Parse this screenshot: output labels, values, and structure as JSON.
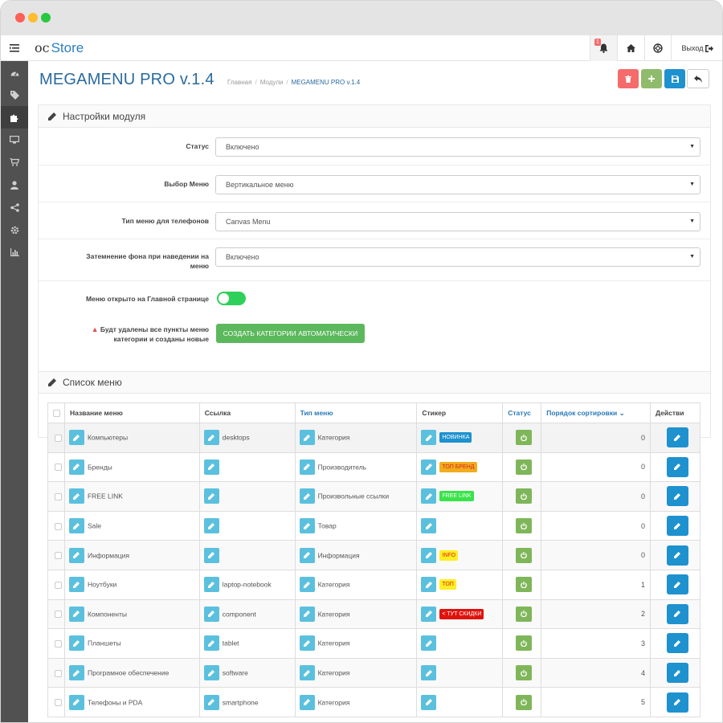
{
  "app": {
    "logo_oc": "oc",
    "logo_store": "Store",
    "notification_count": "1",
    "logout_label": "Выход"
  },
  "sidebar": {
    "items": [
      "dashboard-icon",
      "tags-icon",
      "puzzle-icon",
      "desktop-icon",
      "cart-icon",
      "user-icon",
      "share-icon",
      "gear-icon",
      "bar-chart-icon"
    ],
    "active_index": 2
  },
  "page": {
    "title": "MEGAMENU PRO v.1.4",
    "breadcrumb": [
      "Главная",
      "Модули",
      "MEGAMENU PRO v.1.4"
    ]
  },
  "settings": {
    "heading": "Настройки модуля",
    "status_label": "Статус",
    "status_value": "Включено",
    "menu_choice_label": "Выбор Меню",
    "menu_choice_value": "Вертикальное меню",
    "phone_menu_label": "Тип меню для телефонов",
    "phone_menu_value": "Canvas Menu",
    "dim_label_line1": "Затемнение фона при наведении на",
    "dim_label_line2": "меню",
    "dim_value": "Включено",
    "open_home_label": "Меню открыто на Главной странице",
    "open_home_on": true,
    "warning_line1": "Будт удалены все пункты меню",
    "warning_line2": "категории и созданы новые",
    "create_button": "СОЗДАТЬ КАТЕГОРИИ АВТОМАТИЧЕСКИ"
  },
  "list": {
    "heading": "Список меню",
    "columns": {
      "name": "Название меню",
      "link": "Ссылка",
      "type": "Тип меню",
      "sticker": "Стикер",
      "status": "Статус",
      "sort": "Порядок сортировки",
      "actions": "Действи"
    },
    "rows": [
      {
        "name": "Компьютеры",
        "link": "desktops",
        "type": "Категория",
        "sticker": "НОВИНКА",
        "sticker_bg": "#1e91cf",
        "sticker_fg": "#ffffff",
        "sort": "0"
      },
      {
        "name": "Бренды",
        "link": "",
        "type": "Производитель",
        "sticker": "ТОП БРЕНД",
        "sticker_bg": "#f0ad1e",
        "sticker_fg": "#d9231c",
        "sort": "0"
      },
      {
        "name": "FREE LINK",
        "link": "",
        "type": "Произвольные ссылки",
        "sticker": "FREE LINK",
        "sticker_bg": "#39e34a",
        "sticker_fg": "#ffffff",
        "sort": "0"
      },
      {
        "name": "Sale",
        "link": "",
        "type": "Товар",
        "sticker": "",
        "sticker_bg": "",
        "sticker_fg": "",
        "sort": "0"
      },
      {
        "name": "Информация",
        "link": "",
        "type": "Информация",
        "sticker": "INFO",
        "sticker_bg": "#ffee22",
        "sticker_fg": "#d9231c",
        "sort": "0"
      },
      {
        "name": "Ноутбуки",
        "link": "laptop-notebook",
        "type": "Категория",
        "sticker": "ТОП",
        "sticker_bg": "#ffee22",
        "sticker_fg": "#d9231c",
        "sort": "1"
      },
      {
        "name": "Компоненты",
        "link": "component",
        "type": "Категория",
        "sticker": "< ТУТ СКИДКИ",
        "sticker_bg": "#e0120e",
        "sticker_fg": "#ffffff",
        "sort": "2"
      },
      {
        "name": "Планшеты",
        "link": "tablet",
        "type": "Категория",
        "sticker": "",
        "sticker_bg": "",
        "sticker_fg": "",
        "sort": "3"
      },
      {
        "name": "Програмное обеспечение",
        "link": "software",
        "type": "Категория",
        "sticker": "",
        "sticker_bg": "",
        "sticker_fg": "",
        "sort": "4"
      },
      {
        "name": "Телефоны и PDA",
        "link": "smartphone",
        "type": "Категория",
        "sticker": "",
        "sticker_bg": "",
        "sticker_fg": "",
        "sort": "5"
      }
    ]
  }
}
